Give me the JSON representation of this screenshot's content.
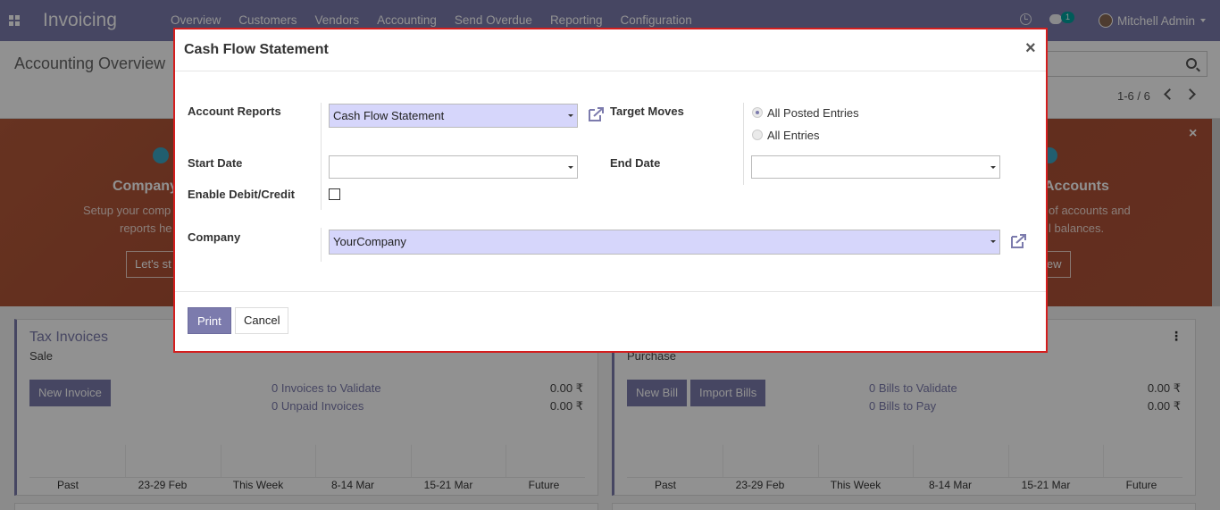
{
  "navbar": {
    "app_title": "Invoicing",
    "menu": [
      "Overview",
      "Customers",
      "Vendors",
      "Accounting",
      "Send Overdue",
      "Reporting",
      "Configuration"
    ],
    "chat_badge": "1",
    "user_name": "Mitchell Admin"
  },
  "control_panel": {
    "breadcrumb": "Accounting Overview",
    "pager": "1-6 / 6"
  },
  "banner": {
    "close": "×",
    "left_step": {
      "title": "Company",
      "desc_line1": "Setup your comp",
      "desc_line2": "reports he",
      "button": "Let's st"
    },
    "right_step": {
      "title": "Accounts",
      "desc_line1": "of accounts and",
      "desc_line2": "l balances.",
      "button": "iew"
    }
  },
  "cards": [
    {
      "title": "Tax Invoices",
      "subtitle": "Sale",
      "buttons": [
        "New Invoice"
      ],
      "links": [
        "0 Invoices to Validate",
        "0 Unpaid Invoices"
      ],
      "amounts": [
        "0.00 ₹",
        "0.00 ₹"
      ],
      "axis": [
        "Past",
        "23-29 Feb",
        "This Week",
        "8-14 Mar",
        "15-21 Mar",
        "Future"
      ]
    },
    {
      "title": "",
      "subtitle": "Purchase",
      "buttons": [
        "New Bill",
        "Import Bills"
      ],
      "links": [
        "0 Bills to Validate",
        "0 Bills to Pay"
      ],
      "amounts": [
        "0.00 ₹",
        "0.00 ₹"
      ],
      "axis": [
        "Past",
        "23-29 Feb",
        "This Week",
        "8-14 Mar",
        "15-21 Mar",
        "Future"
      ]
    }
  ],
  "modal": {
    "title": "Cash Flow Statement",
    "close": "×",
    "fields": {
      "account_reports_label": "Account Reports",
      "account_reports_value": "Cash Flow Statement",
      "target_moves_label": "Target Moves",
      "target_moves_options": [
        "All Posted Entries",
        "All Entries"
      ],
      "target_moves_selected": "All Posted Entries",
      "start_date_label": "Start Date",
      "start_date_value": "",
      "end_date_label": "End Date",
      "end_date_value": "",
      "debit_credit_label": "Enable Debit/Credit",
      "debit_credit_checked": false,
      "company_label": "Company",
      "company_value": "YourCompany"
    },
    "footer": {
      "print": "Print",
      "cancel": "Cancel"
    }
  },
  "colors": {
    "primary": "#7c7bad",
    "modal_border": "#d41e1e",
    "select_bg": "#d6d6fb"
  }
}
